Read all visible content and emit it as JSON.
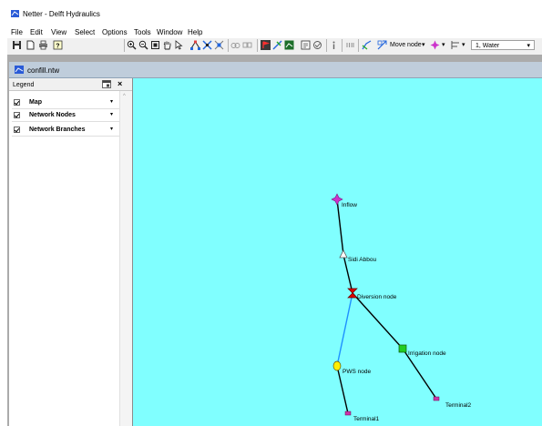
{
  "window": {
    "title": "Netter - Delft Hydraulics"
  },
  "menu": {
    "items": [
      "File",
      "Edit",
      "View",
      "Select",
      "Options",
      "Tools",
      "Window",
      "Help"
    ]
  },
  "toolbar": {
    "move_node_label": "Move node",
    "water_combo_value": "1, Water"
  },
  "document": {
    "title": "confill.ntw"
  },
  "legend": {
    "title": "Legend",
    "layers": [
      {
        "label": "Map",
        "checked": true
      },
      {
        "label": "Network Nodes",
        "checked": true
      },
      {
        "label": "Network Branches",
        "checked": true
      }
    ]
  },
  "network": {
    "nodes": [
      {
        "id": "inflow",
        "label": "Inflow",
        "type": "inflow"
      },
      {
        "id": "sidi-abbou",
        "label": "Sidi Abbou",
        "type": "reservoir"
      },
      {
        "id": "diversion",
        "label": "Diversion node",
        "type": "diversion"
      },
      {
        "id": "irrigation",
        "label": "Irrigation node",
        "type": "irrigation"
      },
      {
        "id": "pws",
        "label": "PWS node",
        "type": "pws"
      },
      {
        "id": "terminal1",
        "label": "Terminal1",
        "type": "terminal"
      },
      {
        "id": "terminal2",
        "label": "Terminal2",
        "type": "terminal"
      }
    ],
    "branches": [
      {
        "from": "inflow",
        "to": "sidi-abbou",
        "kind": "river"
      },
      {
        "from": "sidi-abbou",
        "to": "diversion",
        "kind": "river"
      },
      {
        "from": "diversion",
        "to": "pws",
        "kind": "diversion"
      },
      {
        "from": "diversion",
        "to": "irrigation",
        "kind": "river"
      },
      {
        "from": "irrigation",
        "to": "terminal2",
        "kind": "river"
      },
      {
        "from": "pws",
        "to": "terminal1",
        "kind": "river"
      }
    ],
    "colors": {
      "canvas": "#80ffff",
      "river": "#000000",
      "diversion": "#1e90ff",
      "inflow": "#cc33cc",
      "diversion_node": "#dd0000",
      "irrigation": "#22cc22",
      "pws": "#ffee00",
      "terminal": "#cc33aa"
    }
  }
}
